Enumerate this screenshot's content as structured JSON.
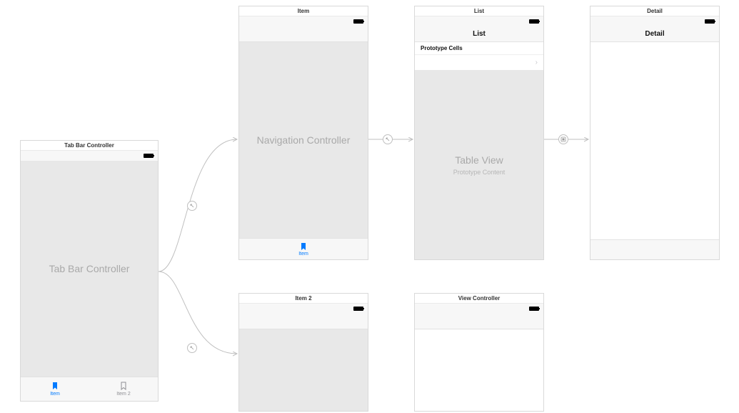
{
  "scenes": {
    "tabBar": {
      "title": "Tab Bar Controller",
      "placeholder": "Tab Bar Controller",
      "tabs": [
        {
          "label": "Item",
          "selected": true
        },
        {
          "label": "Item 2",
          "selected": false
        }
      ]
    },
    "item": {
      "title": "Item",
      "placeholder": "Navigation Controller",
      "tabLabel": "Item"
    },
    "list": {
      "title": "List",
      "navTitle": "List",
      "prototypeHeader": "Prototype Cells",
      "placeholder": "Table View",
      "placeholderSub": "Prototype Content"
    },
    "detail": {
      "title": "Detail",
      "navTitle": "Detail"
    },
    "item2": {
      "title": "Item 2"
    },
    "viewController": {
      "title": "View Controller"
    }
  },
  "colors": {
    "tint": "#007aff",
    "inactive": "#8e8e93"
  }
}
